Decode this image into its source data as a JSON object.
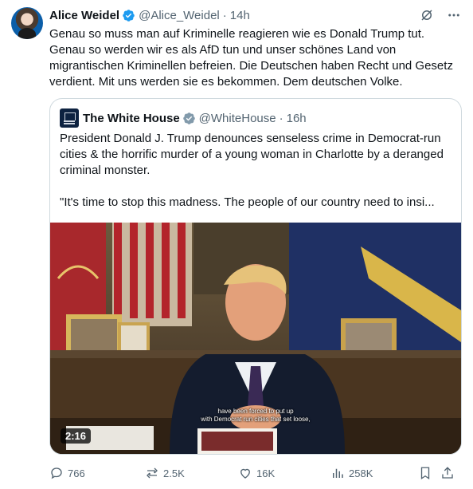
{
  "author": {
    "name": "Alice Weidel",
    "handle": "@Alice_Weidel",
    "separator": "·",
    "time": "14h"
  },
  "tweet_text": "Genau so muss man auf Kriminelle reagieren wie es Donald Trump tut. Genau so werden wir es als AfD tun und unser schönes Land von migrantischen Kriminellen befreien. Die Deutschen haben Recht und Gesetz verdient. Mit uns werden sie es bekommen. Dem deutschen Volke.",
  "quote": {
    "name": "The White House",
    "handle": "@WhiteHouse",
    "separator": "·",
    "time": "16h",
    "paragraph1": "President Donald J. Trump denounces senseless crime in Democrat-run cities & the horrific murder of a young woman in Charlotte by a deranged criminal monster.",
    "paragraph2": "\"It's time to stop this madness. The people of our country need to insi...",
    "video": {
      "duration": "2:16",
      "subtitle_line1": "have been forced to put up",
      "subtitle_line2": "with Democrat run cities that set loose,"
    }
  },
  "actions": {
    "replies": "766",
    "reposts": "2.5K",
    "likes": "16K",
    "views": "258K"
  },
  "colors": {
    "verified_blue": "#1d9bf0",
    "verified_gray": "#829aab",
    "secondary_text": "#536471",
    "border": "#cfd9de"
  },
  "icons": [
    "verified-badge-icon",
    "grok-icon",
    "more-icon",
    "reply-icon",
    "repost-icon",
    "like-icon",
    "views-icon",
    "bookmark-icon",
    "share-icon"
  ]
}
